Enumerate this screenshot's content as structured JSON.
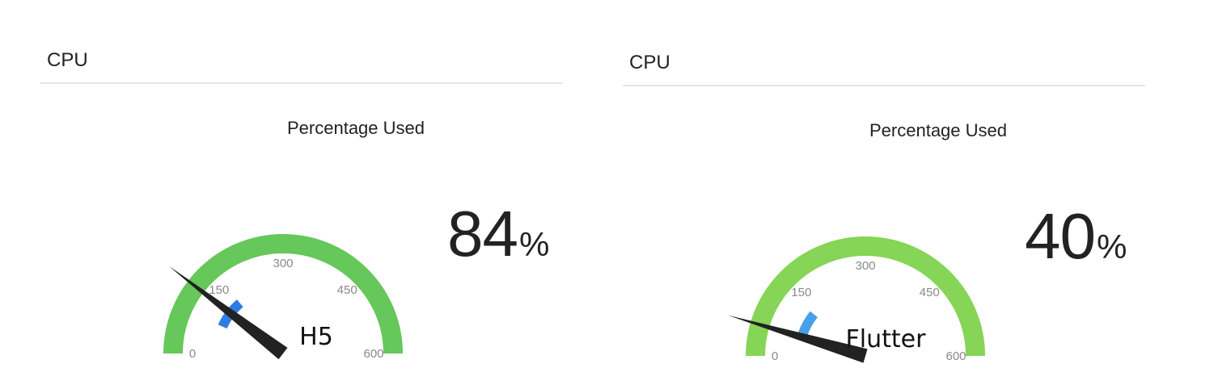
{
  "panels": [
    {
      "title": "CPU",
      "subtitle": "Percentage Used",
      "percent_value": "84",
      "percent_unit": "%",
      "caption": "H5",
      "gauge": {
        "min": 0,
        "max": 600,
        "ticks": [
          "0",
          "150",
          "300",
          "450",
          "600"
        ],
        "needle_value": 125,
        "inner_arc_start": 80,
        "inner_arc_end": 165,
        "outer_color": "#66c75a",
        "inner_color": "#2f7de1",
        "needle_color": "#222222"
      }
    },
    {
      "title": "CPU",
      "subtitle": "Percentage Used",
      "percent_value": "40",
      "percent_unit": "%",
      "caption": "Flutter",
      "gauge": {
        "min": 0,
        "max": 600,
        "ticks": [
          "0",
          "150",
          "300",
          "450",
          "600"
        ],
        "needle_value": 55,
        "inner_arc_start": 65,
        "inner_arc_end": 130,
        "outer_color": "#86d556",
        "inner_color": "#48a0e8",
        "needle_color": "#222222"
      }
    }
  ]
}
